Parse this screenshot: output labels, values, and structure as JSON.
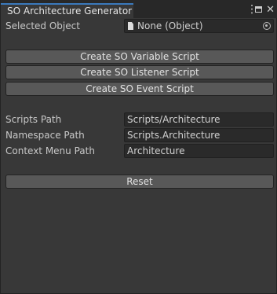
{
  "window": {
    "tab_title": "SO Architecture Generator",
    "menu_glyph": "⋮",
    "close_glyph": "✕"
  },
  "selected_object": {
    "label": "Selected Object",
    "value": "None (Object)"
  },
  "buttons": {
    "create_variable": "Create SO Variable Script",
    "create_listener": "Create SO Listener Script",
    "create_event": "Create SO Event Script",
    "reset": "Reset"
  },
  "fields": {
    "scripts_path": {
      "label": "Scripts Path",
      "value": "Scripts/Architecture"
    },
    "namespace_path": {
      "label": "Namespace Path",
      "value": "Scripts.Architecture"
    },
    "context_menu_path": {
      "label": "Context Menu Path",
      "value": "Architecture"
    }
  },
  "colors": {
    "panel_bg": "#383838",
    "button_bg": "#585858",
    "field_bg": "#2a2a2a",
    "tab_accent": "#3a79bb"
  },
  "icons": {
    "object": "file-icon",
    "picker": "object-picker-icon",
    "menu": "kebab-menu-icon",
    "maximize": "maximize-icon",
    "close": "close-icon"
  }
}
